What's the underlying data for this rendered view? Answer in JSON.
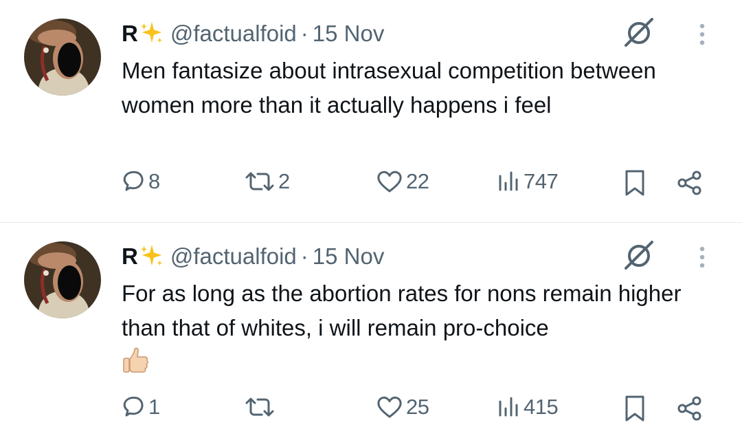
{
  "colors": {
    "text": "#0f1419",
    "secondary": "#536471",
    "divider": "#e6e9ec",
    "sparkle": "#f7c21b"
  },
  "tweets": [
    {
      "author_name": "R",
      "handle": "@factualfoid",
      "separator": "·",
      "date": "15 Nov",
      "text": "Men fantasize about intrasexual competition between women more than it actually happens i feel",
      "emoji": null,
      "replies": "8",
      "reposts": "2",
      "likes": "22",
      "views": "747"
    },
    {
      "author_name": "R",
      "handle": "@factualfoid",
      "separator": "·",
      "date": "15 Nov",
      "text": "For as long as the abortion rates for nons remain higher than that of whites, i will remain pro-choice",
      "emoji": "thumbs-up-emoji",
      "replies": "1",
      "reposts": "",
      "likes": "25",
      "views": "415"
    }
  ],
  "icons": [
    "sparkle-icon",
    "grok-icon",
    "more-icon",
    "reply-icon",
    "repost-icon",
    "like-icon",
    "views-icon",
    "bookmark-icon",
    "share-icon"
  ]
}
